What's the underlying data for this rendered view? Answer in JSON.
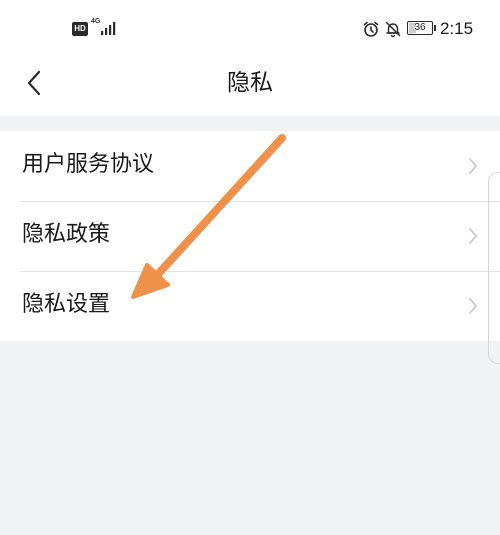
{
  "status_bar": {
    "hd_label": "HD",
    "network_label": "4G",
    "battery_level": "36",
    "time": "2:15",
    "icons": [
      "signal-icon",
      "alarm-icon",
      "bell-off-icon",
      "battery-icon"
    ]
  },
  "header": {
    "title": "隐私",
    "back_icon": "chevron-left-icon"
  },
  "list": {
    "items": [
      {
        "label": "用户服务协议",
        "icon": "chevron-right-icon"
      },
      {
        "label": "隐私政策",
        "icon": "chevron-right-icon"
      },
      {
        "label": "隐私设置",
        "icon": "chevron-right-icon"
      }
    ]
  },
  "annotation": {
    "arrow_color": "#f0914a",
    "points_to": "隐私设置"
  },
  "colors": {
    "background": "#f1f2f4",
    "surface": "#ffffff",
    "text": "#1a1a1a",
    "divider": "#e3e3e3",
    "chevron": "#c4c4c4"
  }
}
